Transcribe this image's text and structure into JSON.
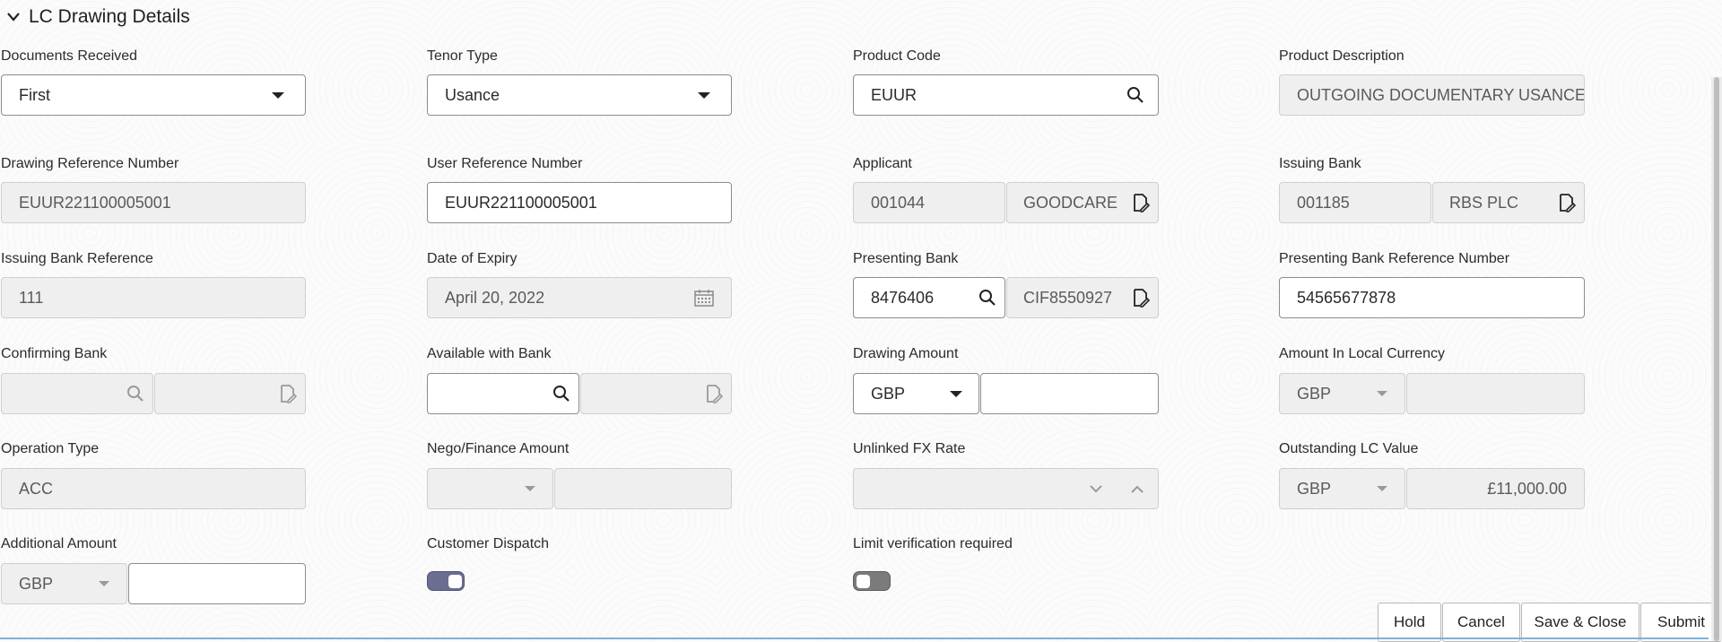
{
  "section": {
    "title": "LC Drawing Details"
  },
  "fields": {
    "documents_received": {
      "label": "Documents Received",
      "value": "First"
    },
    "tenor_type": {
      "label": "Tenor Type",
      "value": "Usance"
    },
    "product_code": {
      "label": "Product Code",
      "value": "EUUR"
    },
    "product_description": {
      "label": "Product Description",
      "value": "OUTGOING DOCUMENTARY USANCE"
    },
    "drawing_reference_number": {
      "label": "Drawing Reference Number",
      "value": "EUUR221100005001"
    },
    "user_reference_number": {
      "label": "User Reference Number",
      "value": "EUUR221100005001"
    },
    "applicant": {
      "label": "Applicant",
      "id": "001044",
      "name": "GOODCARE"
    },
    "issuing_bank": {
      "label": "Issuing Bank",
      "id": "001185",
      "name": "RBS PLC"
    },
    "issuing_bank_reference": {
      "label": "Issuing Bank Reference",
      "value": "111"
    },
    "date_of_expiry": {
      "label": "Date of Expiry",
      "value": "April 20, 2022"
    },
    "presenting_bank": {
      "label": "Presenting Bank",
      "id": "8476406",
      "name": "CIF8550927"
    },
    "presenting_bank_reference_number": {
      "label": "Presenting Bank Reference Number",
      "value": "54565677878"
    },
    "confirming_bank": {
      "label": "Confirming Bank",
      "id": "",
      "name": ""
    },
    "available_with_bank": {
      "label": "Available with Bank",
      "id": "",
      "name": ""
    },
    "drawing_amount": {
      "label": "Drawing Amount",
      "currency": "GBP",
      "amount": ""
    },
    "amount_in_local_currency": {
      "label": "Amount In Local Currency",
      "currency": "GBP",
      "amount": ""
    },
    "operation_type": {
      "label": "Operation Type",
      "value": "ACC"
    },
    "nego_finance_amount": {
      "label": "Nego/Finance Amount",
      "currency": "",
      "amount": ""
    },
    "unlinked_fx_rate": {
      "label": "Unlinked FX Rate",
      "value": ""
    },
    "outstanding_lc_value": {
      "label": "Outstanding LC Value",
      "currency": "GBP",
      "amount": "£11,000.00"
    },
    "additional_amount": {
      "label": "Additional Amount",
      "currency": "GBP",
      "amount": ""
    },
    "customer_dispatch": {
      "label": "Customer Dispatch",
      "on": true
    },
    "limit_verification_required": {
      "label": "Limit verification required",
      "on": false
    }
  },
  "buttons": {
    "hold": "Hold",
    "cancel": "Cancel",
    "save_close": "Save & Close",
    "submit": "Submit"
  },
  "colors": {
    "toggle_on": "#6a6f91",
    "toggle_off": "#7b7b7b"
  }
}
